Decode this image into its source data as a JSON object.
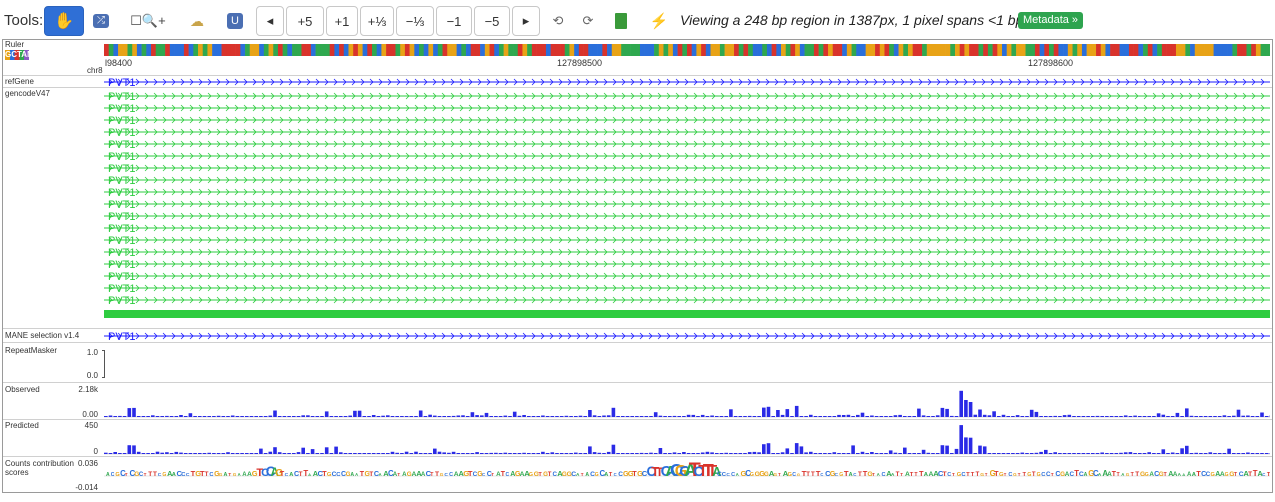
{
  "toolbar": {
    "label": "Tools:",
    "buttons": {
      "prev": "◂",
      "plus5": "+5",
      "plus1": "+1",
      "plus_third": "+⅓",
      "minus_third": "−⅓",
      "minus1": "−1",
      "minus5": "−5",
      "next": "▸",
      "undo": "⟲",
      "redo": "⟳"
    },
    "status": "Viewing a 248 bp region in 1387px, 1 pixel spans <1 bp",
    "metadata_button": "Metadata »"
  },
  "ruler": {
    "label": "Ruler",
    "base_legend": "GCTAN",
    "chrom": "chr8",
    "ticks": [
      {
        "label": "l98400",
        "pos": 0.0
      },
      {
        "label": "127898500",
        "pos": 0.395
      },
      {
        "label": "127898600",
        "pos": 0.79
      }
    ]
  },
  "tracks": {
    "refgene": {
      "label": "refGene",
      "gene": "PVT1"
    },
    "gencode": {
      "label": "gencodeV47",
      "gene": "PVT1",
      "transcripts": 18
    },
    "mane": {
      "label": "MANE selection v1.4",
      "gene": "PVT1"
    },
    "repeatmasker": {
      "label": "RepeatMasker",
      "ymax": "1.0",
      "ymin": "0.0"
    },
    "observed": {
      "label": "Observed",
      "ymax": "2.18k",
      "ymin": "0.00"
    },
    "predicted": {
      "label": "Predicted",
      "ymax": "450",
      "ymin": "0"
    },
    "contrib": {
      "label": "Counts contribution scores",
      "ymax": "0.036",
      "ymin": "-0.014"
    }
  },
  "colors": {
    "accent": "#2f6fd6",
    "gene_blue": "#1a1aff",
    "gene_green": "#2ecc40",
    "signal": "#2a2ae6",
    "metadata_green": "#2ea44f",
    "base_G": "#e8a317",
    "base_C": "#2a6fdb",
    "base_T": "#d9332b",
    "base_A": "#2fa84f",
    "base_N": "#8a5cc2"
  }
}
